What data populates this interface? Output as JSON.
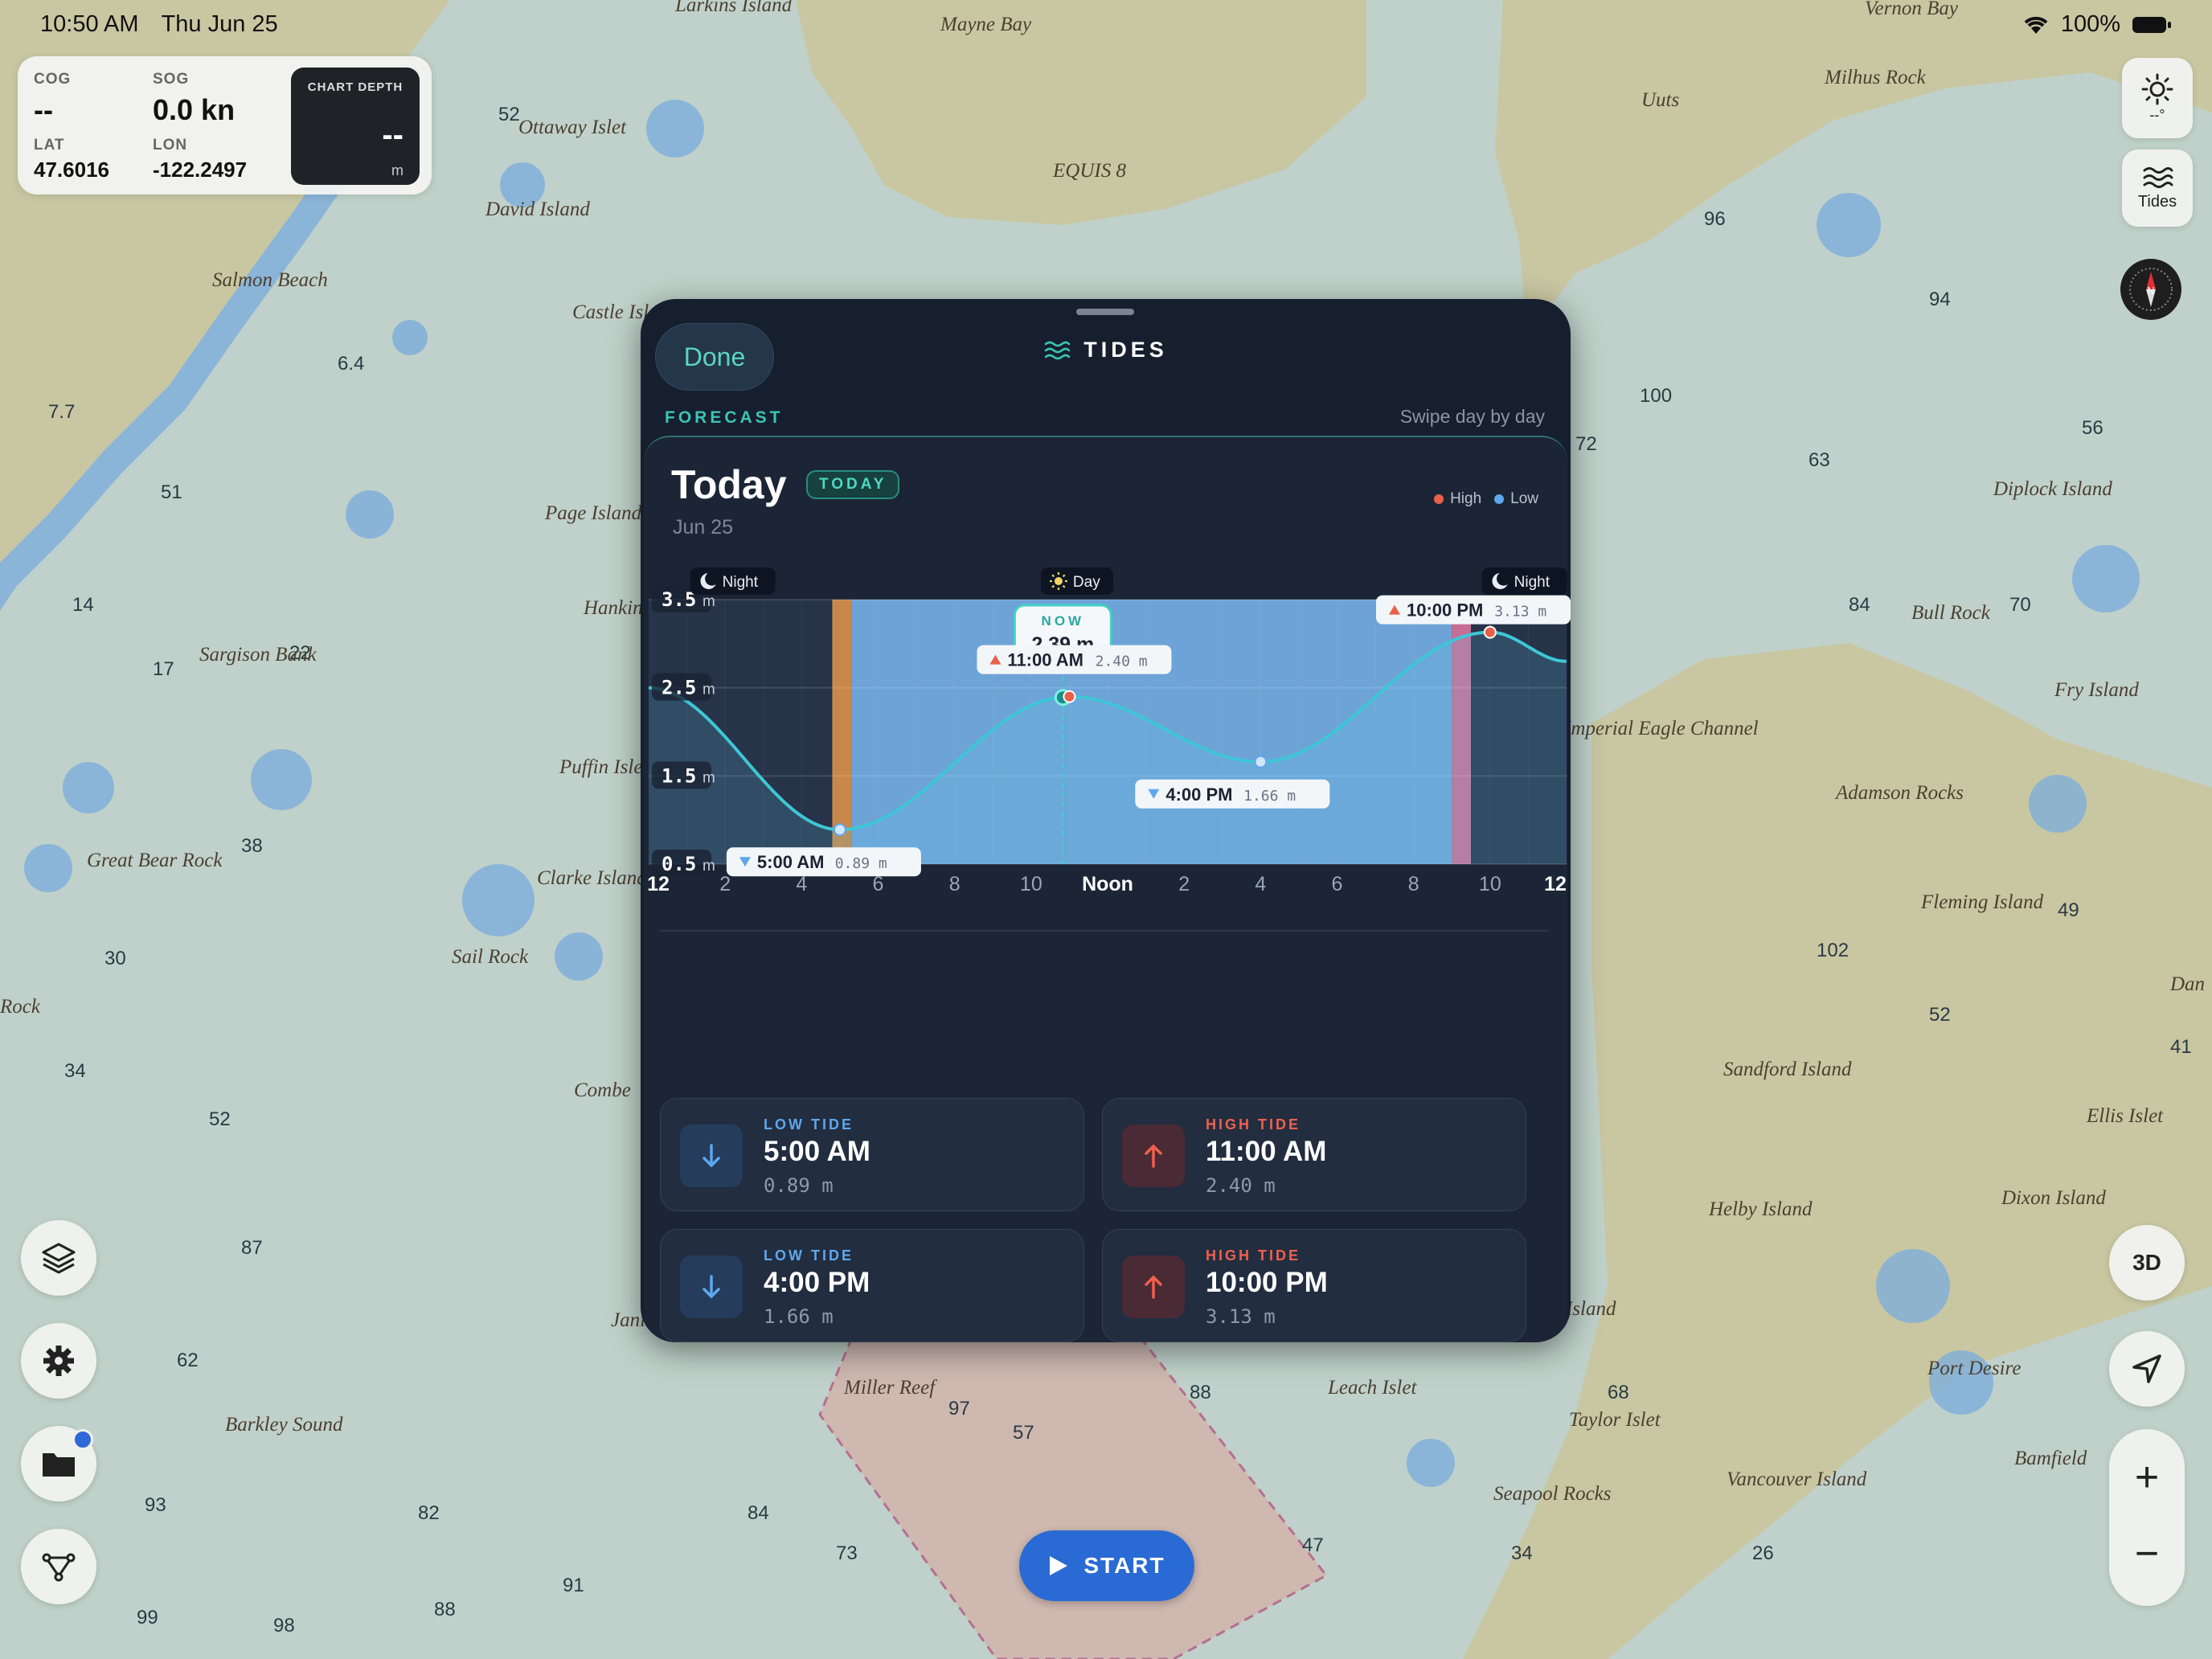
{
  "status_bar": {
    "time": "10:50 AM",
    "date": "Thu Jun 25",
    "battery": "100%",
    "icons": [
      "wifi-icon",
      "battery-icon"
    ]
  },
  "nav": {
    "cog_label": "COG",
    "cog_value": "--",
    "sog_label": "SOG",
    "sog_value": "0.0 kn",
    "lat_label": "LAT",
    "lat_value": "47.6016",
    "lon_label": "LON",
    "lon_value": "-122.2497",
    "depth_label": "CHART DEPTH",
    "depth_value": "--",
    "depth_unit": "m"
  },
  "right_controls": {
    "light_label": "--°",
    "tides_label": "Tides",
    "compass_label": "N",
    "view_3d_label": "3D",
    "zoom_in": "+",
    "zoom_out": "−"
  },
  "start_button": {
    "label": "START"
  },
  "map_labels": [
    "Larkins Island",
    "Mayne Bay",
    "Vernon Bay",
    "Milhus Rock",
    "Uuts",
    "Ottaway Islet",
    "David Island",
    "Salmon Beach",
    "Castle Islet",
    "Page Island",
    "Hankin",
    "Sargison Bank",
    "Puffin Isle",
    "Clarke Island",
    "Sail Rock",
    "Great Bear Rock",
    "Combe",
    "Jani",
    "Barkley Sound",
    "Miller Reef",
    "Leach Islet",
    "Taylor Islet",
    "Seapool Rocks",
    "Diplock Island",
    "Bull Rock",
    "Fry Island",
    "Imperial Eagle Channel",
    "Adamson Rocks",
    "Fleming Island",
    "Sandford Island",
    "Ellis Islet",
    "Helby Island",
    "Dixon Island",
    "Port Desire",
    "Bamfield",
    "Vancouver Island",
    "EQUIS 8",
    "Island",
    "Rock",
    "Dan"
  ],
  "tides_sheet": {
    "done_label": "Done",
    "title": "TIDES",
    "forecast_label": "FORECAST",
    "swipe_hint": "Swipe day by day",
    "day_title": "Today",
    "today_badge": "TODAY",
    "date": "Jun 25",
    "legend_high": "High",
    "legend_low": "Low"
  },
  "chart_data": {
    "type": "area",
    "x_unit": "hour of day",
    "y_unit": "m",
    "xlim": [
      0,
      24
    ],
    "ylim": [
      0.5,
      3.5
    ],
    "y_ticks": [
      0.5,
      1.5,
      2.5,
      3.5
    ],
    "y_tick_labels": [
      "0.5",
      "1.5",
      "2.5",
      "3.5"
    ],
    "x_ticks": [
      0,
      2,
      4,
      6,
      8,
      10,
      12,
      14,
      16,
      18,
      20,
      22,
      24
    ],
    "x_tick_labels": [
      "12",
      "2",
      "4",
      "6",
      "8",
      "10",
      "Noon",
      "2",
      "4",
      "6",
      "8",
      "10",
      "12"
    ],
    "series": [
      {
        "x": [
          0,
          5,
          11,
          16,
          22,
          24
        ],
        "y": [
          2.5,
          0.89,
          2.4,
          1.66,
          3.13,
          2.8
        ]
      }
    ],
    "extremes": [
      {
        "kind": "low",
        "hour": 5,
        "time": "5:00 AM",
        "height": "0.89 m",
        "value": 0.89
      },
      {
        "kind": "high",
        "hour": 11,
        "time": "11:00 AM",
        "height": "2.40 m",
        "value": 2.4
      },
      {
        "kind": "low",
        "hour": 16,
        "time": "4:00 PM",
        "height": "1.66 m",
        "value": 1.66
      },
      {
        "kind": "high",
        "hour": 22,
        "time": "10:00 PM",
        "height": "3.13 m",
        "value": 3.13
      }
    ],
    "now": {
      "label": "NOW",
      "hour": 10.83,
      "value": 2.39,
      "value_label": "2.39 m"
    },
    "periods": [
      {
        "label": "Night",
        "start": 0,
        "end": 4.8,
        "icon": "moon-icon"
      },
      {
        "label": "",
        "start": 4.8,
        "end": 5.3,
        "kind": "sunrise"
      },
      {
        "label": "Day",
        "start": 5.3,
        "end": 21,
        "icon": "sun-icon"
      },
      {
        "label": "",
        "start": 21,
        "end": 21.5,
        "kind": "sunset"
      },
      {
        "label": "Night",
        "start": 21.5,
        "end": 24,
        "icon": "moon-icon"
      }
    ],
    "colors": {
      "high": "#e8604a",
      "low": "#5ea7ec",
      "curve": "#3ec6d6",
      "day": "#6ea3d8",
      "night": "#263349",
      "sunrise": "#c9874a",
      "sunset": "#c76e96"
    }
  },
  "tide_tiles": [
    {
      "kind": "LOW TIDE",
      "time": "5:00 AM",
      "height": "0.89 m",
      "direction": "down"
    },
    {
      "kind": "HIGH TIDE",
      "time": "11:00 AM",
      "height": "2.40 m",
      "direction": "up"
    },
    {
      "kind": "LOW TIDE",
      "time": "4:00 PM",
      "height": "1.66 m",
      "direction": "down"
    },
    {
      "kind": "HIGH TIDE",
      "time": "10:00 PM",
      "height": "3.13 m",
      "direction": "up"
    }
  ]
}
